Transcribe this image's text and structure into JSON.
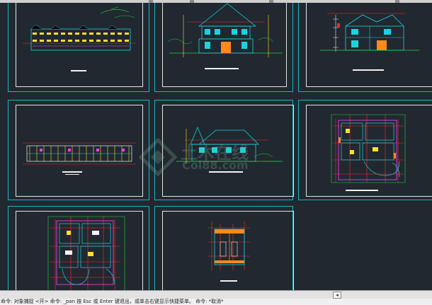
{
  "app": {
    "command_line": "命令: 对象捕捉 <开> 命令: _pan 按 Esc 或 Enter 键退出，或单击右键显示快捷菜单。 命令: *取消*"
  },
  "watermark": {
    "text_cn": "土木在线",
    "text_en": "Col88.com"
  },
  "scrollbar": {
    "arrow_glyph": "◂"
  },
  "sheets": [
    {
      "id": "s1",
      "content": "street-elevation"
    },
    {
      "id": "s2",
      "content": "villa-front-elevation"
    },
    {
      "id": "s3",
      "content": "villa-section"
    },
    {
      "id": "s4",
      "content": "row-plan"
    },
    {
      "id": "s5",
      "content": "villa-side-elevation"
    },
    {
      "id": "s6",
      "content": "floor-plan-1"
    },
    {
      "id": "s7",
      "content": "floor-plan-2"
    },
    {
      "id": "s8",
      "content": "roof-plan"
    }
  ],
  "colors": {
    "canvas": "#212830",
    "sheet_frame": "#14b8c4",
    "paper_frame": "#e6e6e6",
    "cyan": "#19d4e0",
    "red": "#ff2a2a",
    "green": "#2ad24a",
    "yellow": "#ffe030",
    "white": "#f2f2f2",
    "magenta": "#ff40ff",
    "orange": "#ff8a1a"
  }
}
